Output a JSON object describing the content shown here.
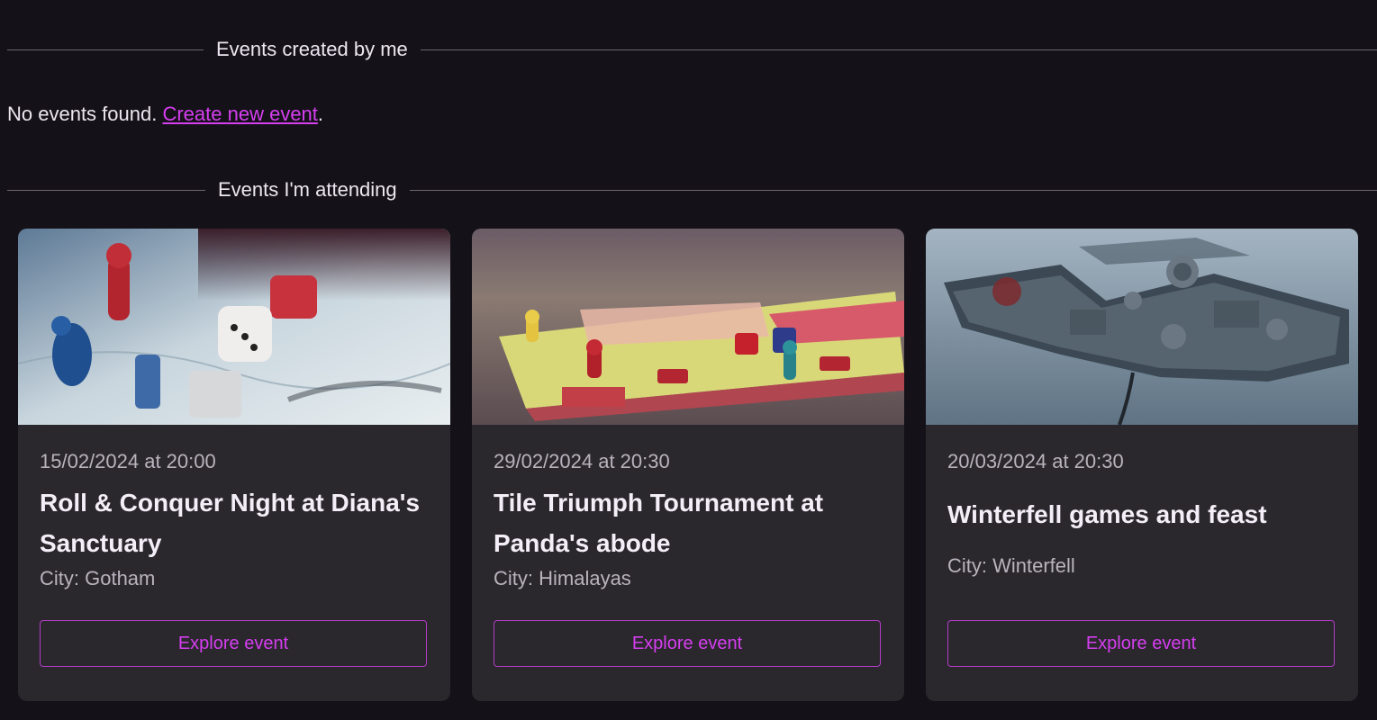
{
  "sections": {
    "created": {
      "title": "Events created by me",
      "empty_text": "No events found.",
      "create_link": "Create new event",
      "trailing": "."
    },
    "attending": {
      "title": "Events I'm attending"
    }
  },
  "events": [
    {
      "date": "15/02/2024 at 20:00",
      "title": "Roll & Conquer Night at Diana's Sanctuary",
      "city": "City: Gotham",
      "button": "Explore event",
      "image": "board-game-dice-photo"
    },
    {
      "date": "29/02/2024 at 20:30",
      "title": "Tile Triumph Tournament at Panda's abode",
      "city": "City: Himalayas",
      "button": "Explore event",
      "image": "monopoly-board-photo"
    },
    {
      "date": "20/03/2024 at 20:30",
      "title": "Winterfell games and feast",
      "city": "City: Winterfell",
      "button": "Explore event",
      "image": "snowy-castle-photo"
    }
  ],
  "colors": {
    "background": "#141218",
    "card": "#2a272d",
    "accent": "#d63ef0",
    "muted_text": "#b9b3bd"
  }
}
